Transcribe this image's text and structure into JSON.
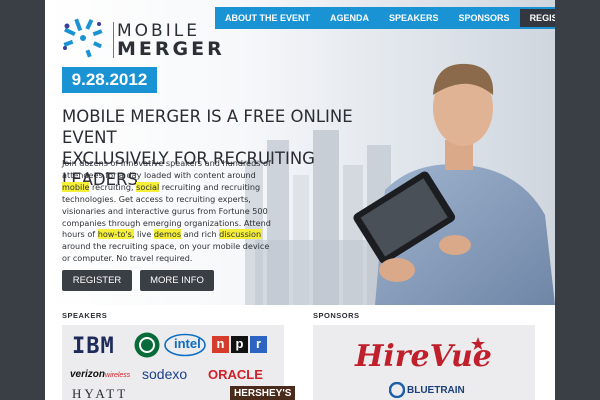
{
  "brand": {
    "line1": "MOBILE",
    "line2": "MERGER",
    "accent": "#1a93d4"
  },
  "nav": {
    "items": [
      "ABOUT THE EVENT",
      "AGENDA",
      "SPEAKERS",
      "SPONSORS"
    ],
    "register": "REGISTER"
  },
  "hero": {
    "date": "9.28.2012",
    "headline_line1": "MOBILE MERGER IS A FREE ONLINE EVENT",
    "headline_line2": "EXCLUSIVELY FOR RECRUITING LEADERS.",
    "body": {
      "p1": "Join dozens of innovative speakers and hundreds of attendees for a day loaded with content around ",
      "hl1": "mobile",
      "p2": " recruiting, ",
      "hl2": "social",
      "p3": " recruiting and recruiting technologies. Get access to recruiting experts, visionaries and interactive gurus from Fortune 500 companies through emerging organizations. Attend hours of ",
      "hl3": "how-to's,",
      "p4": " live ",
      "hl4": "demos",
      "p5": " and rich ",
      "hl5": "discussion",
      "p6": " around the recruiting space, on your mobile device or computer. No travel required."
    },
    "register_button": "REGISTER",
    "more_info_button": "MORE INFO"
  },
  "speakers": {
    "title": "SPEAKERS",
    "logos": {
      "ibm": "IBM",
      "intel": "intel",
      "npr_n": "n",
      "npr_p": "p",
      "npr_r": "r",
      "verizon": "verizon",
      "verizon_sub": "wireless",
      "sodexo": "sodexo",
      "oracle": "ORACLE",
      "hyatt": "HYATT",
      "hersheys": "HERSHEY'S"
    }
  },
  "sponsors": {
    "title": "SPONSORS",
    "logos": {
      "hirevue": "HireVue",
      "bluetrain": "BLUETRAIN"
    }
  }
}
